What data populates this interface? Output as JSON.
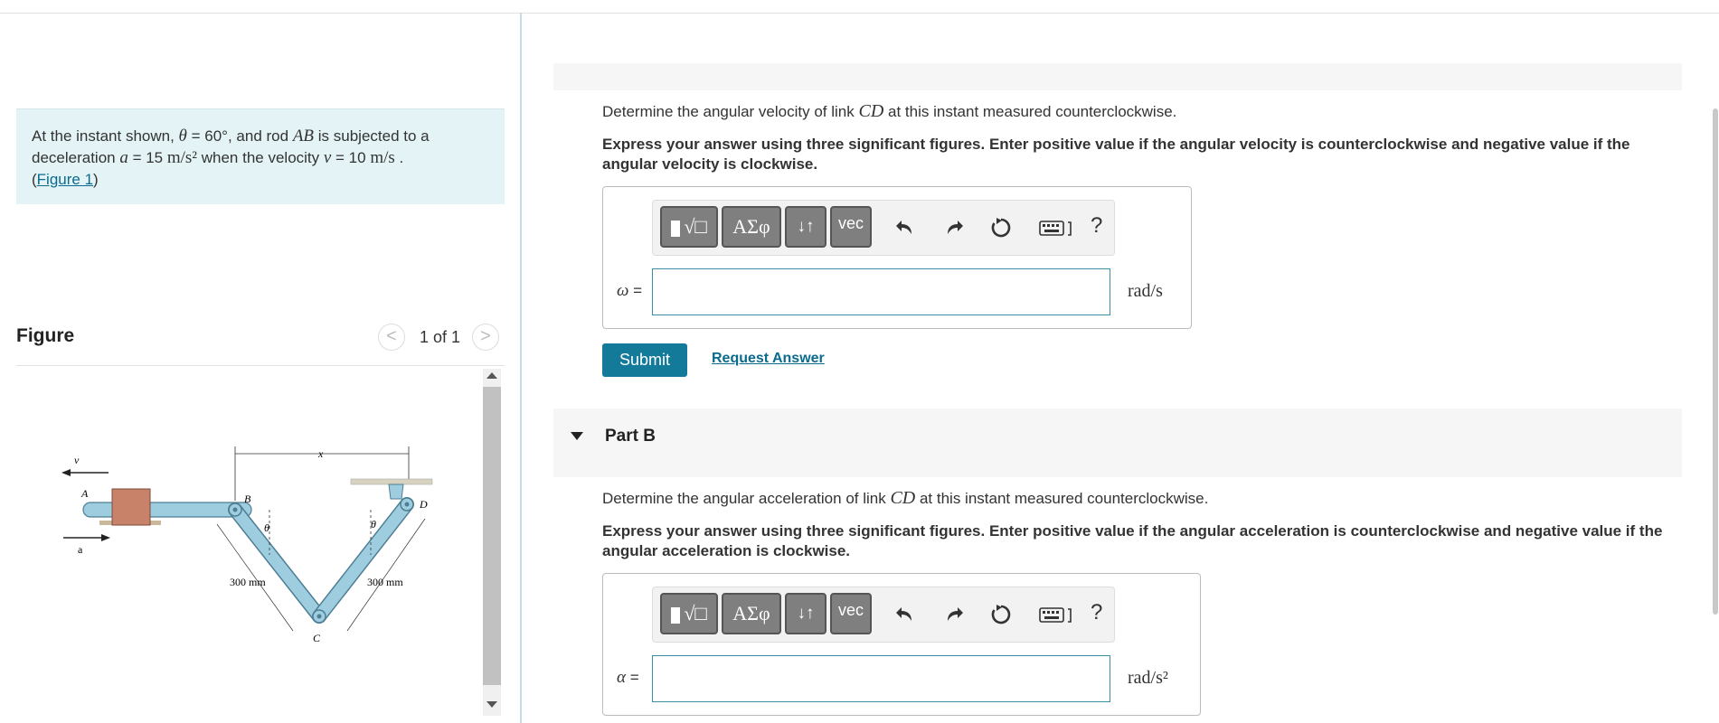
{
  "problem": {
    "intro": "At the instant shown, ",
    "theta_sym": "θ",
    "theta_val": " = 60°",
    "mid1": ", and rod ",
    "rod": "AB",
    "mid2": " is subjected to a deceleration ",
    "a_sym": "a",
    "a_eq": " = 15 ",
    "a_unit": "m/s²",
    "mid3": " when the velocity ",
    "v_sym": "v",
    "v_eq": " = 10 ",
    "v_unit": "m/s",
    "end": " .",
    "figure_link_open": "(",
    "figure_link": "Figure 1",
    "figure_link_close": ")"
  },
  "figure": {
    "title": "Figure",
    "prev_icon": "chevron-left-icon",
    "next_icon": "chevron-right-icon",
    "prev_glyph": "<",
    "next_glyph": ">",
    "counter": "1 of 1",
    "labels": {
      "v": "v",
      "a": "a",
      "A": "A",
      "B": "B",
      "C": "C",
      "D": "D",
      "x": "x",
      "theta1": "θ",
      "theta2": "θ",
      "len1": "300 mm",
      "len2": "300 mm"
    }
  },
  "part_a": {
    "question_pre": "Determine the angular velocity of link ",
    "question_var": "CD",
    "question_post": " at this instant measured counterclockwise.",
    "instructions": "Express your answer using three significant figures. Enter positive value if the angular velocity is counterclockwise and negative value if the angular velocity is clockwise.",
    "variable": "ω",
    "equals": " =",
    "unit": "rad/s",
    "input_value": "",
    "submit_label": "Submit",
    "request_label": "Request Answer"
  },
  "part_b": {
    "title": "Part B",
    "question_pre": "Determine the angular acceleration of link ",
    "question_var": "CD",
    "question_post": " at this instant measured counterclockwise.",
    "instructions": "Express your answer using three significant figures. Enter positive value if the angular acceleration is counterclockwise and negative value if the angular acceleration is clockwise.",
    "variable": "α",
    "equals": " =",
    "unit": "rad/s²",
    "input_value": ""
  },
  "toolbar": {
    "templates_label": "√□",
    "greek_label": "ΑΣφ",
    "arrows_label": "↓↑",
    "vec_label": "vec",
    "help_label": "?",
    "icons": [
      "templates-icon",
      "greek-icon",
      "subscript-arrows-icon",
      "vec-icon",
      "undo-icon",
      "redo-icon",
      "reset-icon",
      "keyboard-icon",
      "help-icon"
    ]
  },
  "colors": {
    "accent": "#137a99",
    "link": "#0a6b8e",
    "problem_bg": "#e4f4f6",
    "rod": "#9fcde0",
    "block": "#c8826a"
  }
}
